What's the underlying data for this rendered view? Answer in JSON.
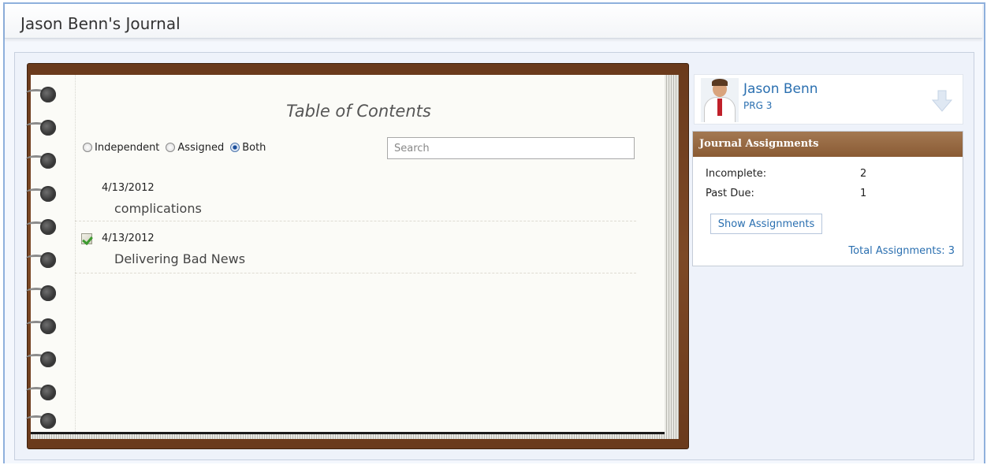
{
  "header": {
    "title": "Jason Benn's Journal"
  },
  "journal": {
    "toc_title": "Table of Contents",
    "filters": [
      {
        "label": "Independent",
        "checked": false
      },
      {
        "label": "Assigned",
        "checked": false
      },
      {
        "label": "Both",
        "checked": true
      }
    ],
    "search": {
      "placeholder": "Search",
      "value": ""
    },
    "entries": [
      {
        "date": "4/13/2012",
        "title": "complications",
        "assigned": false
      },
      {
        "date": "4/13/2012",
        "title": "Delivering Bad News",
        "assigned": true
      }
    ]
  },
  "profile": {
    "name": "Jason Benn",
    "group": "PRG 3",
    "icons": {
      "avatar": "doctor-avatar",
      "action": "download-arrow-icon"
    }
  },
  "assignments": {
    "header": "Journal Assignments",
    "rows": [
      {
        "label": "Incomplete:",
        "value": "2"
      },
      {
        "label": "Past Due:",
        "value": "1"
      }
    ],
    "show_button": "Show Assignments",
    "total_label": "Total Assignments: 3"
  },
  "colors": {
    "link": "#2a6fb0",
    "book_brown": "#7d4926",
    "panel_header": "#8a5b34"
  }
}
